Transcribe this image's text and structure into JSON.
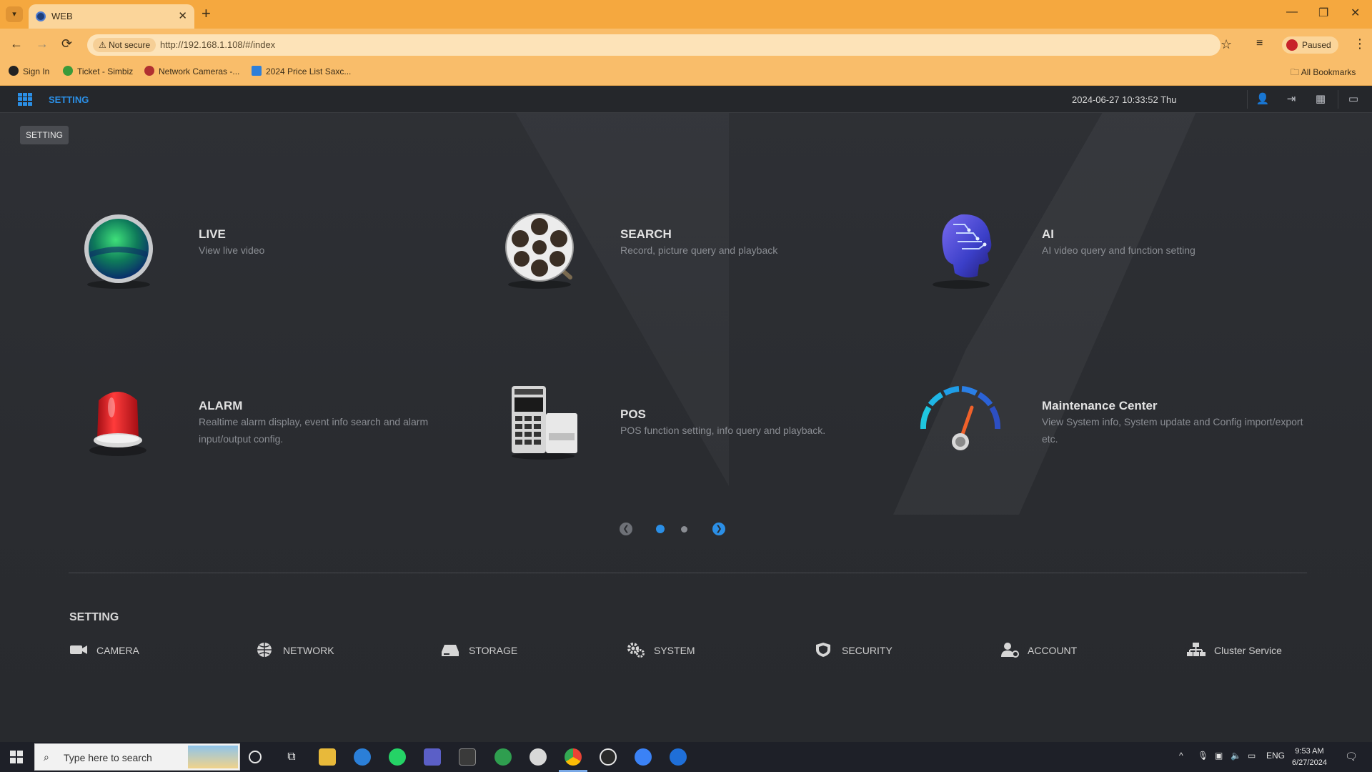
{
  "browser": {
    "tab_title": "WEB",
    "tab_close": "✕",
    "new_tab": "+",
    "security_label": "⚠ Not secure",
    "url": "http://192.168.1.108/#/index",
    "profile_label": "Paused",
    "bookmarks": [
      {
        "label": "Sign In",
        "color": "#222222"
      },
      {
        "label": "Ticket - Simbiz",
        "color": "#3a9a3a"
      },
      {
        "label": "Network Cameras -...",
        "color": "#b03030"
      },
      {
        "label": "2024 Price List Saxc...",
        "color": "#2f7fd8"
      }
    ],
    "all_bookmarks": "All Bookmarks"
  },
  "app": {
    "title": "SETTING",
    "datetime": "2024-06-27 10:33:52 Thu",
    "tooltip": "SETTING",
    "accent": "#2b8fe6",
    "tiles": [
      {
        "title": "LIVE",
        "desc": "View live video"
      },
      {
        "title": "SEARCH",
        "desc": "Record, picture query and playback"
      },
      {
        "title": "AI",
        "desc": "AI video query and function setting"
      },
      {
        "title": "ALARM",
        "desc": "Realtime alarm display, event info search and alarm input/output config."
      },
      {
        "title": "POS",
        "desc": "POS function setting, info query and playback."
      },
      {
        "title": "Maintenance Center",
        "desc": "View System info, System update and Config import/export etc."
      }
    ],
    "pager": {
      "current_page": 1,
      "total_pages": 2
    },
    "settings_heading": "SETTING",
    "settings": [
      {
        "label": "CAMERA",
        "icon": "camera-icon"
      },
      {
        "label": "NETWORK",
        "icon": "network-icon"
      },
      {
        "label": "STORAGE",
        "icon": "storage-icon"
      },
      {
        "label": "SYSTEM",
        "icon": "system-gears-icon"
      },
      {
        "label": "SECURITY",
        "icon": "security-shield-icon"
      },
      {
        "label": "ACCOUNT",
        "icon": "account-icon"
      },
      {
        "label": "Cluster Service",
        "icon": "cluster-icon"
      }
    ]
  },
  "taskbar": {
    "search_placeholder": "Type here to search",
    "language": "ENG",
    "time": "9:53 AM",
    "date": "6/27/2024"
  }
}
